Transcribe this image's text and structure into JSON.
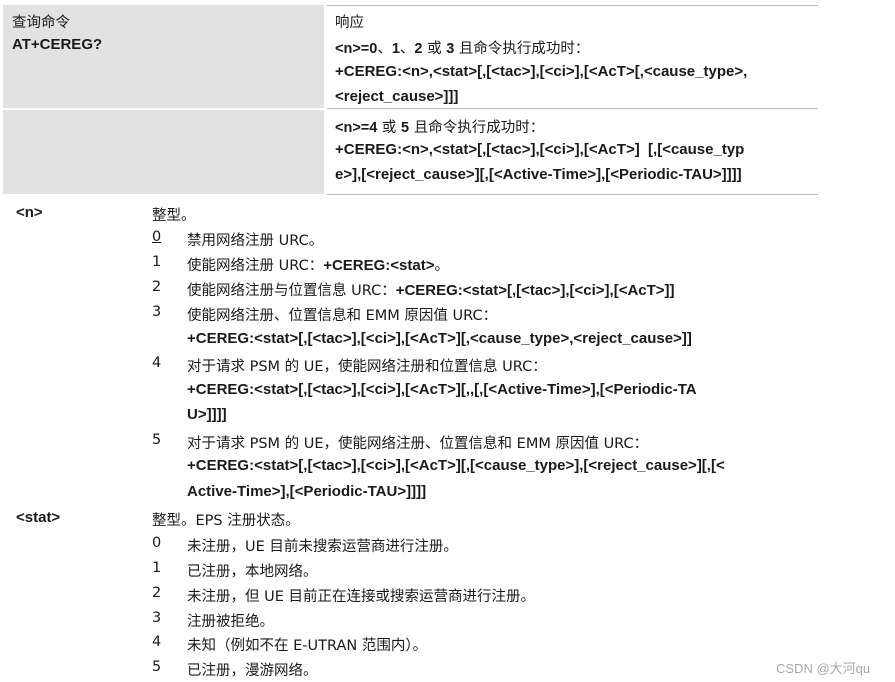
{
  "table": {
    "header_left_line1": "查询命令",
    "header_left_line2": "AT+CEREG?",
    "resp_title": "响应",
    "row1_cond_pre": "<n>=0",
    "row1_cond_mid1": "、",
    "row1_cond_v1": "1",
    "row1_cond_mid2": "、",
    "row1_cond_v2": "2",
    "row1_cond_mid3": " 或 ",
    "row1_cond_v3": "3",
    "row1_cond_post": " 且命令执行成功时：",
    "row1_line1": "+CEREG:<n>,<stat>[,[<tac>],[<ci>],[<AcT>[,<cause_type>,",
    "row1_line2": "<reject_cause>]]]",
    "row2_cond_pre": "<n>=4",
    "row2_cond_mid": " 或 ",
    "row2_cond_v": "5",
    "row2_cond_post": " 且命令执行成功时：",
    "row2_line1": "+CEREG:<n>,<stat>[,[<tac>],[<ci>],[<AcT>]  [,[<cause_typ",
    "row2_line2": "e>],[<reject_cause>][,[<Active-Time>],[<Periodic-TAU>]]]]"
  },
  "param_n": {
    "name": "<n>",
    "type": "整型。",
    "items": [
      {
        "num": "0",
        "text": "禁用网络注册 URC。"
      },
      {
        "num": "1",
        "text": "使能网络注册 URC：",
        "cmd": "+CEREG:<stat>",
        "tail": "。"
      },
      {
        "num": "2",
        "text": "使能网络注册与位置信息 URC：",
        "cmd": "+CEREG:<stat>[,[<tac>],[<ci>],[<AcT>]]"
      },
      {
        "num": "3",
        "text": "使能网络注册、位置信息和 EMM 原因值 URC：",
        "cmd": "+CEREG:<stat>[,[<tac>],[<ci>],[<AcT>][,<cause_type>,<reject_cause>]]"
      },
      {
        "num": "4",
        "text": "对于请求 PSM 的 UE，使能网络注册和位置信息 URC：",
        "cmd1": "+CEREG:<stat>[,[<tac>],[<ci>],[<AcT>][,,[,[<Active-Time>],[<Periodic-TA",
        "cmd2": "U>]]]]"
      },
      {
        "num": "5",
        "text": "对于请求 PSM 的 UE，使能网络注册、位置信息和 EMM 原因值 URC：",
        "cmd1": "+CEREG:<stat>[,[<tac>],[<ci>],[<AcT>][,[<cause_type>],[<reject_cause>][,[<",
        "cmd2": "Active-Time>],[<Periodic-TAU>]]]]"
      }
    ]
  },
  "param_stat": {
    "name": "<stat>",
    "type": "整型。EPS 注册状态。",
    "items": [
      {
        "num": "0",
        "text": "未注册，UE 目前未搜索运营商进行注册。"
      },
      {
        "num": "1",
        "text": "已注册，本地网络。"
      },
      {
        "num": "2",
        "text": "未注册，但 UE 目前正在连接或搜索运营商进行注册。"
      },
      {
        "num": "3",
        "text": "注册被拒绝。"
      },
      {
        "num": "4",
        "text": "未知（例如不在 E-UTRAN 范围内）。"
      },
      {
        "num": "5",
        "text": "已注册，漫游网络。"
      }
    ]
  },
  "watermark": "CSDN @大河qu"
}
